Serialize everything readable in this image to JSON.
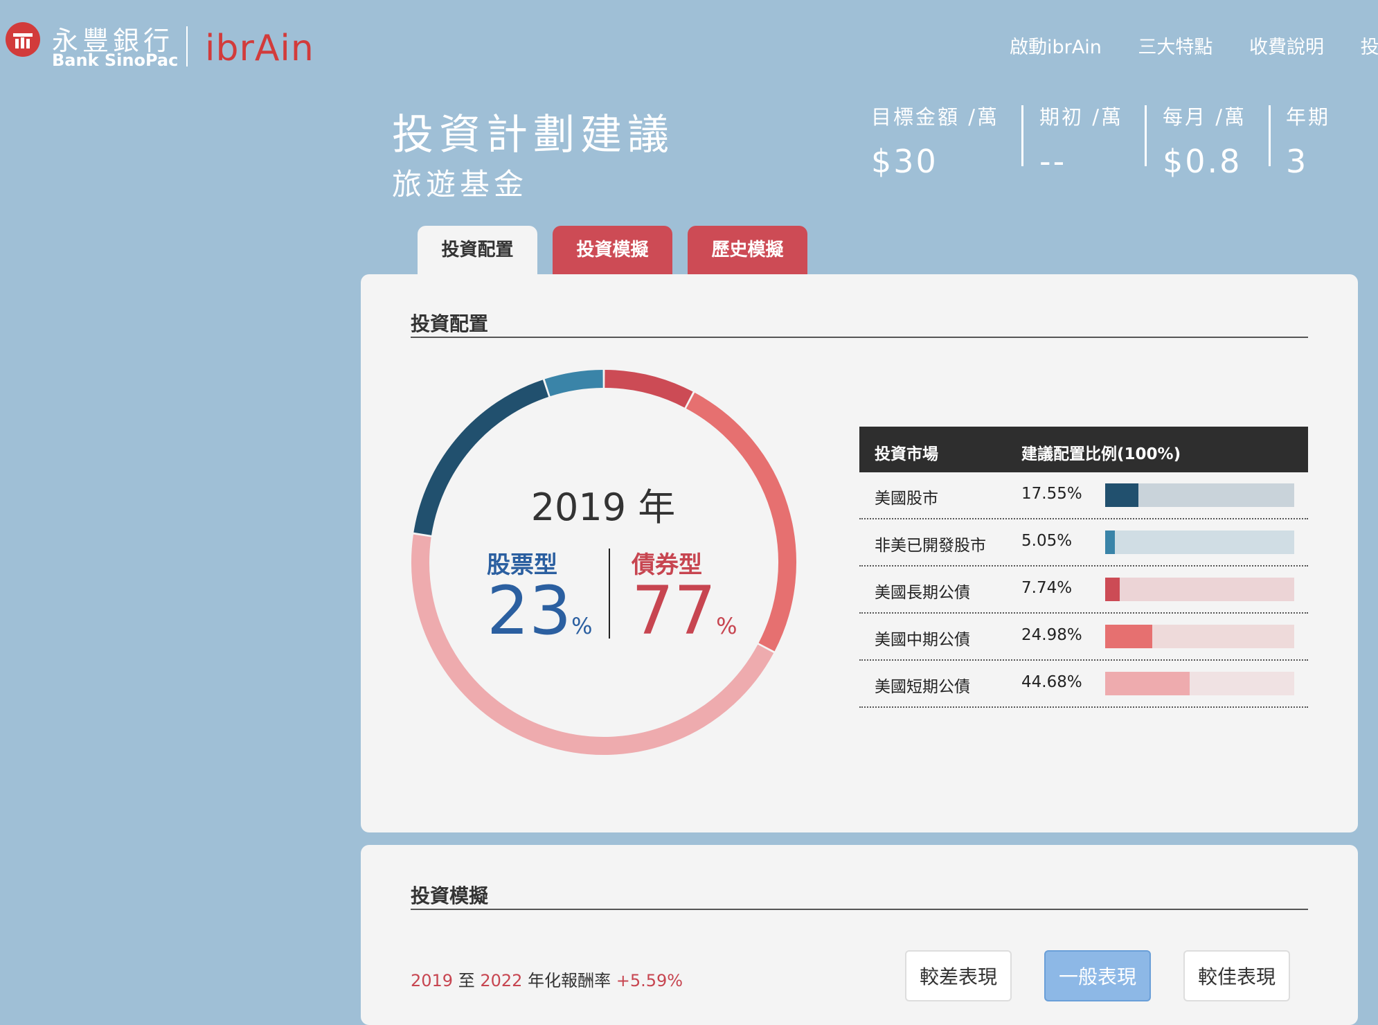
{
  "header": {
    "bank_name_cn": "永豐銀行",
    "bank_name_en": "Bank SinoPac",
    "brand_part1": "ibr",
    "brand_part2": "Ain",
    "nav": [
      "啟動ibrAin",
      "三大特點",
      "收費說明",
      "投資"
    ]
  },
  "plan": {
    "title": "投資計劃建議",
    "subtitle": "旅遊基金",
    "stats": [
      {
        "label": "目標金額 /萬",
        "value": "$30"
      },
      {
        "label": "期初 /萬",
        "value": "--"
      },
      {
        "label": "每月 /萬",
        "value": "$0.8"
      },
      {
        "label": "年期",
        "value": "3"
      }
    ]
  },
  "tabs": [
    "投資配置",
    "投資模擬",
    "歷史模擬"
  ],
  "allocation": {
    "section_title": "投資配置",
    "year_label": "2019 年",
    "stock_label": "股票型",
    "stock_pct": "23",
    "bond_label": "債券型",
    "bond_pct": "77",
    "pct_symbol": "%",
    "table_header": {
      "market": "投資市場",
      "ratio": "建議配置比例(100%)"
    },
    "rows": [
      {
        "name": "美國股市",
        "pct": "17.55%",
        "value": 17.55,
        "color": "#21506e",
        "track": "#c9d3da"
      },
      {
        "name": "非美已開發股市",
        "pct": "5.05%",
        "value": 5.05,
        "color": "#3a84a8",
        "track": "#d0dde4"
      },
      {
        "name": "美國長期公債",
        "pct": "7.74%",
        "value": 7.74,
        "color": "#cc4b55",
        "track": "#ecd4d6"
      },
      {
        "name": "美國中期公債",
        "pct": "24.98%",
        "value": 24.98,
        "color": "#e67070",
        "track": "#eedada"
      },
      {
        "name": "美國短期公債",
        "pct": "44.68%",
        "value": 44.68,
        "color": "#eeabae",
        "track": "#f0e2e3"
      }
    ]
  },
  "simulation": {
    "section_title": "投資模擬",
    "start_year": "2019",
    "to_word": "至",
    "end_year": "2022",
    "return_label": "年化報酬率",
    "return_value": "+5.59%",
    "buttons": [
      "較差表現",
      "一般表現",
      "較佳表現"
    ],
    "selected_button": "一般表現"
  },
  "colors": {
    "background": "#9fbfd6",
    "accent_red": "#cd4b55",
    "stock_blue": "#2b5fa0",
    "bond_red": "#c74550"
  },
  "icons": {
    "logo": "sinopac-logo-icon"
  }
}
